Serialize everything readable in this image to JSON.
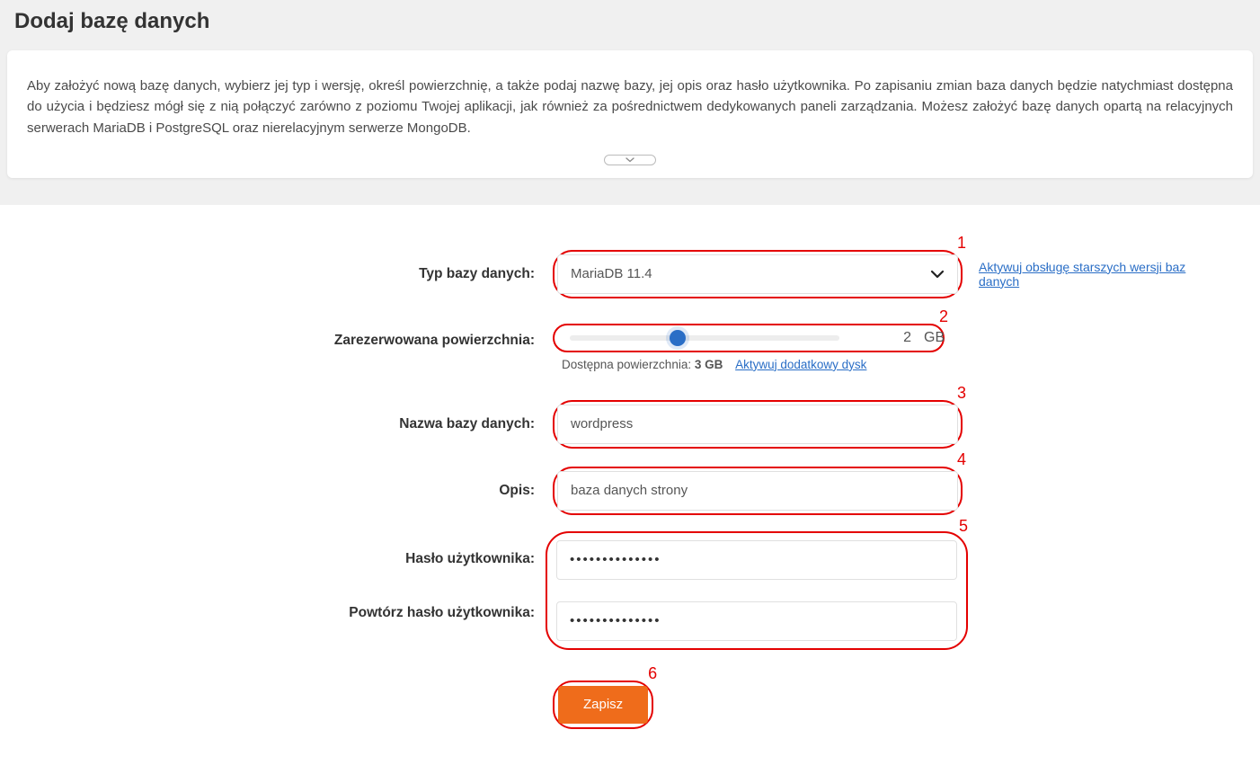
{
  "header": {
    "title": "Dodaj bazę danych"
  },
  "info": {
    "text": "Aby założyć nową bazę danych, wybierz jej typ i wersję, określ powierzchnię, a także podaj nazwę bazy, jej opis oraz hasło użytkownika. Po zapisaniu zmian baza danych będzie natychmiast dostępna do użycia i będziesz mógł się z nią połączyć zarówno z poziomu Twojej aplikacji, jak również za pośrednictwem dedykowanych paneli zarządzania. Możesz założyć bazę danych opartą na relacyjnych serwerach MariaDB i PostgreSQL oraz nierelacyjnym serwerze MongoDB."
  },
  "form": {
    "db_type": {
      "label": "Typ bazy danych:",
      "value": "MariaDB 11.4",
      "side_link": "Aktywuj obsługę starszych wersji baz danych"
    },
    "space": {
      "label": "Zarezerwowana powierzchnia:",
      "value": "2",
      "unit": "GB",
      "available_label": "Dostępna powierzchnia: ",
      "available_value": "3 GB",
      "extra_link": "Aktywuj dodatkowy dysk"
    },
    "db_name": {
      "label": "Nazwa bazy danych:",
      "value": "wordpress"
    },
    "description": {
      "label": "Opis:",
      "value": "baza danych strony"
    },
    "password": {
      "label": "Hasło użytkownika:",
      "value": "••••••••••••••"
    },
    "password_repeat": {
      "label": "Powtórz hasło użytkownika:",
      "value": "••••••••••••••"
    },
    "submit": {
      "label": "Zapisz"
    }
  },
  "annotations": {
    "n1": "1",
    "n2": "2",
    "n3": "3",
    "n4": "4",
    "n5": "5",
    "n6": "6"
  }
}
